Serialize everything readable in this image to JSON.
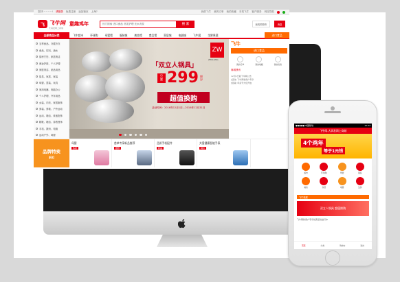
{
  "topbar": {
    "greeting": "您好!~~~~!",
    "login": "请登录",
    "register": "免费注册",
    "shop": "返回首页",
    "home": "上海?",
    "links": [
      "我的飞牛",
      "我的订单",
      "我的收藏",
      "手机飞牛",
      "客户服务",
      "网站导航"
    ]
  },
  "header": {
    "logo_mark": "飞",
    "logo_text": "飞牛网",
    "logo_sub": "大润发网上商城",
    "slogan": "童趣鸡年",
    "search_placeholder": "热门搜索 进口食品 洗发护理 无水洗发",
    "search_button": "搜 索",
    "cart": "我的购物车",
    "msg": "消息"
  },
  "nav": {
    "all_categories": "全部商品分类",
    "items": [
      "飞牛超市",
      "环球购",
      "母婴馆",
      "服装城",
      "美妆馆",
      "食品馆",
      "家居城",
      "电器城",
      "飞牛团",
      "生鲜果蔬"
    ],
    "promo": "进口食品"
  },
  "sidebar": {
    "categories": [
      "当季食品、冷藏冷冻",
      "食品、饮料、酒水",
      "厨房烹饪、家居清洁",
      "美妆护肤、个人护理",
      "家庭清洁、纸品用品",
      "厨具、家居、家装",
      "母婴、童装、玩具",
      "家用电器、电脑办公",
      "个人护理、汽车用品",
      "女装、内衣、家居服饰",
      "男装、男鞋、户外运动",
      "运动、箱包、珠宝配饰",
      "鞋靴、箱包、钟表首饰",
      "手机、数码、电脑",
      "运动户外、母婴",
      "图书音像、其他"
    ]
  },
  "banner": {
    "headline": "「双立人锅具」",
    "price_tag": "只要",
    "price": "299",
    "price_unit": "积分",
    "deal": "超值换购",
    "period": "活动时间：2016年12月1日—2016年12月31日",
    "brand_logo": "ZW",
    "brand_name": "ZWILLING"
  },
  "right_panel": {
    "promo_sign": "飞牛",
    "promo_label": "进口食品",
    "quick_links": [
      "我的订单",
      "我的收藏",
      "我的优惠"
    ],
    "news": [
      "12月1日起飞牛网公告",
      "[活动] 飞牛网新用户专享",
      "[促销] 年货节大促开启"
    ],
    "news_title": "商城快讯"
  },
  "products": [
    {
      "title": "品牌特卖",
      "badge": "精品"
    },
    {
      "title": "母婴",
      "badge": "热卖"
    },
    {
      "title": "首单专享新品推荐",
      "badge": "推荐"
    },
    {
      "title": "品质手机配件",
      "badge": "新品"
    },
    {
      "title": "关爱健康智能手表",
      "badge": "特价"
    }
  ],
  "special": {
    "big": "品牌特卖",
    "sm": "折扣"
  },
  "phone": {
    "status_left": "●●●●● 中国移动",
    "status_right": "10:34",
    "title": "飞牛网-大润发网上商城",
    "banner_line1": "4个鸡年",
    "banner_line2": "等于1元钱",
    "icons": [
      "超市",
      "环球购",
      "母婴",
      "服装",
      "美妆",
      "家居",
      "电器",
      "生鲜"
    ],
    "section": "飞牛快报",
    "banner2": "双立人锅具 超值换购",
    "line": "飞牛网新用户专享优惠活动进行中",
    "tabs": [
      "首页",
      "分类",
      "购物车",
      "我的"
    ]
  },
  "colors": {
    "brand": "#e60012",
    "accent": "#ff6a00"
  }
}
